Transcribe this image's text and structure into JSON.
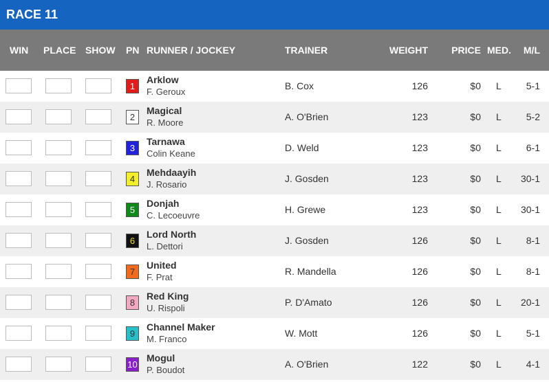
{
  "race": {
    "title": "RACE 11"
  },
  "columns": {
    "win": "WIN",
    "place": "PLACE",
    "show": "SHOW",
    "pn": "PN",
    "runner": "RUNNER / JOCKEY",
    "trainer": "TRAINER",
    "weight": "WEIGHT",
    "price": "PRICE",
    "med": "MED.",
    "ml": "M/L"
  },
  "runners": [
    {
      "pn": "1",
      "name": "Arklow",
      "jockey": "F. Geroux",
      "trainer": "B. Cox",
      "weight": "126",
      "price": "$0",
      "med": "L",
      "ml": "5-1",
      "pn_bg": "#e31b1b",
      "pn_fg": "#ffffff"
    },
    {
      "pn": "2",
      "name": "Magical",
      "jockey": "R. Moore",
      "trainer": "A. O'Brien",
      "weight": "123",
      "price": "$0",
      "med": "L",
      "ml": "5-2",
      "pn_bg": "#ffffff",
      "pn_fg": "#333333"
    },
    {
      "pn": "3",
      "name": "Tarnawa",
      "jockey": "Colin Keane",
      "trainer": "D. Weld",
      "weight": "123",
      "price": "$0",
      "med": "L",
      "ml": "6-1",
      "pn_bg": "#2222dd",
      "pn_fg": "#ffffff"
    },
    {
      "pn": "4",
      "name": "Mehdaayih",
      "jockey": "J. Rosario",
      "trainer": "J. Gosden",
      "weight": "123",
      "price": "$0",
      "med": "L",
      "ml": "30-1",
      "pn_bg": "#f2ee2a",
      "pn_fg": "#333333"
    },
    {
      "pn": "5",
      "name": "Donjah",
      "jockey": "C. Lecoeuvre",
      "trainer": "H. Grewe",
      "weight": "123",
      "price": "$0",
      "med": "L",
      "ml": "30-1",
      "pn_bg": "#0e8a1a",
      "pn_fg": "#ffffff"
    },
    {
      "pn": "6",
      "name": "Lord North",
      "jockey": "L. Dettori",
      "trainer": "J. Gosden",
      "weight": "126",
      "price": "$0",
      "med": "L",
      "ml": "8-1",
      "pn_bg": "#111111",
      "pn_fg": "#f2e027"
    },
    {
      "pn": "7",
      "name": "United",
      "jockey": "F. Prat",
      "trainer": "R. Mandella",
      "weight": "126",
      "price": "$0",
      "med": "L",
      "ml": "8-1",
      "pn_bg": "#f26a1b",
      "pn_fg": "#333333"
    },
    {
      "pn": "8",
      "name": "Red King",
      "jockey": "U. Rispoli",
      "trainer": "P. D'Amato",
      "weight": "126",
      "price": "$0",
      "med": "L",
      "ml": "20-1",
      "pn_bg": "#f4a9c3",
      "pn_fg": "#333333"
    },
    {
      "pn": "9",
      "name": "Channel Maker",
      "jockey": "M. Franco",
      "trainer": "W. Mott",
      "weight": "126",
      "price": "$0",
      "med": "L",
      "ml": "5-1",
      "pn_bg": "#27c0c8",
      "pn_fg": "#333333"
    },
    {
      "pn": "10",
      "name": "Mogul",
      "jockey": "P. Boudot",
      "trainer": "A. O'Brien",
      "weight": "122",
      "price": "$0",
      "med": "L",
      "ml": "4-1",
      "pn_bg": "#8a1ec9",
      "pn_fg": "#ffffff"
    }
  ]
}
